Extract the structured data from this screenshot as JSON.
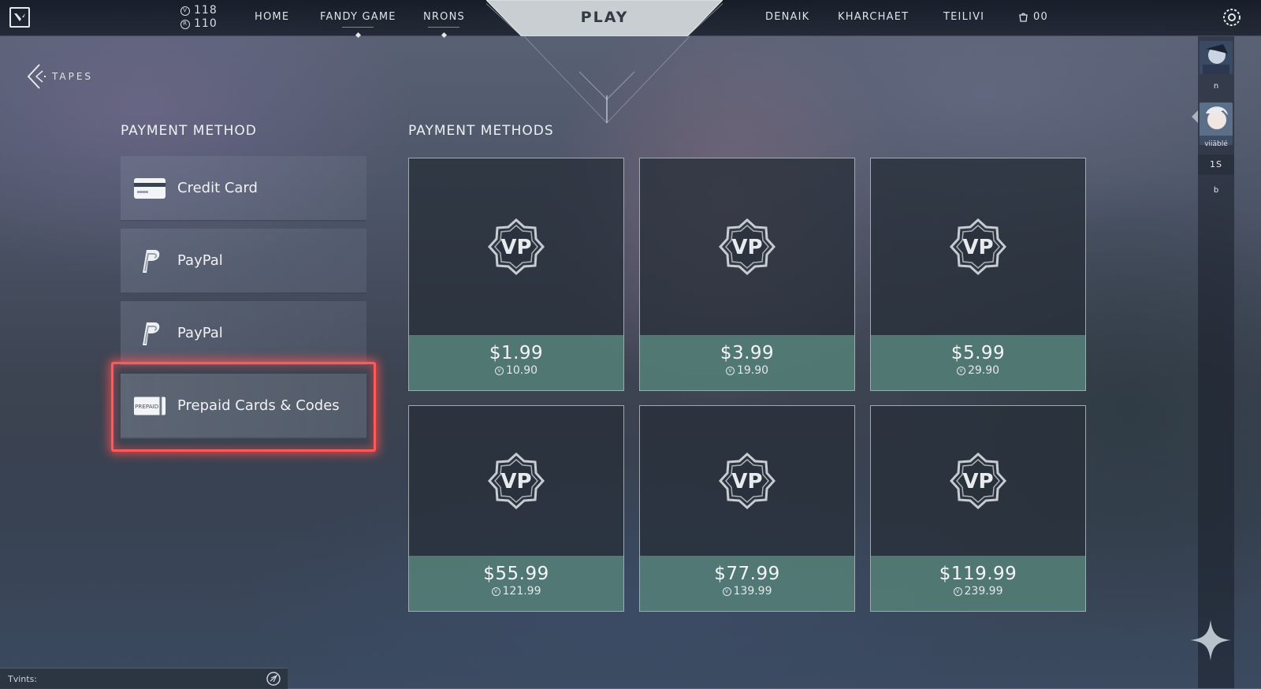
{
  "topbar": {
    "currency": [
      {
        "icon": "valorant-points-icon",
        "value": "118"
      },
      {
        "icon": "radianite-icon",
        "value": "110"
      }
    ],
    "nav_left": [
      {
        "label": "HOME"
      },
      {
        "label": "FANDY GAME"
      },
      {
        "label": "NRONS"
      }
    ],
    "play_label": "PLAY",
    "nav_right": [
      {
        "label": "DENAIK"
      },
      {
        "label": "KHARCHAET"
      },
      {
        "label": "TEILIVI"
      }
    ],
    "store_count": "00"
  },
  "back": {
    "label": "TAPES"
  },
  "payment_method": {
    "title": "PAYMENT METHOD",
    "items": [
      {
        "label": "Credit Card",
        "icon": "credit-card-icon"
      },
      {
        "label": "PayPal",
        "icon": "paypal-icon"
      },
      {
        "label": "PayPal",
        "icon": "paypal-icon"
      },
      {
        "label": "Prepaid Cards & Codes",
        "icon": "prepaid-card-icon",
        "icon_text": "PREPAID",
        "selected": true
      }
    ]
  },
  "payment_methods": {
    "title": "PAYMENT METHODS",
    "badge_text": "VP",
    "packs": [
      {
        "price": "$1.99",
        "points": "10.90"
      },
      {
        "price": "$3.99",
        "points": "19.90"
      },
      {
        "price": "$5.99",
        "points": "29.90"
      },
      {
        "price": "$55.99",
        "points": "121.99"
      },
      {
        "price": "$77.99",
        "points": "139.99"
      },
      {
        "price": "$119.99",
        "points": "239.99"
      }
    ]
  },
  "right_sidebar": {
    "label_1": "n",
    "label_2": "viiāblé",
    "label_3": "1S",
    "label_4": "b"
  },
  "chat": {
    "placeholder": "Tvints:"
  },
  "colors": {
    "accent_teal": "#58847c",
    "highlight_red": "#ff5a5a",
    "topbar": "#121822"
  }
}
